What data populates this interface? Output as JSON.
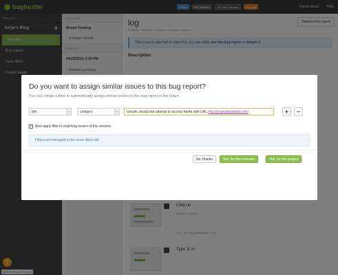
{
  "topbar": {
    "logo": "bugbuster",
    "badges": [
      "Follow",
      "583 followers",
      "42 / 800 minutes",
      "Buy now"
    ],
    "user": "Tuxnet cloud",
    "help": "Help"
  },
  "sidebar": {
    "header": "PROJECT",
    "project": "Jorge's Blog",
    "items": [
      "Test plan",
      "Bug reports",
      "Issue filters",
      "Project details"
    ]
  },
  "col2": {
    "header": "SCENARIO",
    "title": "Bread Testing",
    "item": "Scenario Details",
    "section": "SESSION",
    "date": "04/23/2014, 5:03 PM",
    "summary": "Session summary"
  },
  "main": {
    "title": "log",
    "breadcrumb": "Projects > Test plan > Sessions > Issues in session",
    "detach": "Detach from report",
    "info_prefix": "This issue is attached to report #3, you can either",
    "info_link1": "see the bug report",
    "info_mid": "or",
    "info_link2": "detach it",
    "description": "Description",
    "step1_title": "Click on",
    "step1_sub": "Adjusted element",
    "step1_url": "URL: http://jorgealbaladejo.com/",
    "step2_title": "Type 'a' in"
  },
  "footer": {
    "version": "v2.1.0",
    "terms": "Terms",
    "privacy": "Privacy"
  },
  "modal": {
    "title": "Do you want to assign similar issues to this bug report?",
    "lead": "You can create a filter to automatically assign similar issues to this bug report in the future.",
    "field": "title",
    "operator": "contains",
    "value_text": "Unsafe JavaScript attempt to access frame with URL ",
    "value_url": "http://jorgealbaladejo.com/",
    "add": "+",
    "remove": "−",
    "apply_label": "Also apply filter to matching issues of this session.",
    "note_prefix": "Filters are managed in the ",
    "note_link": "issue filters",
    "note_suffix": " tab",
    "no_thanks": "No, thanks",
    "yes_scenario": "Yes, for this scenario",
    "yes_project": "Yes, for this project"
  },
  "colors": {
    "accent": "#8cbf4c",
    "topbar": "#3b3b3b",
    "sidebar": "#454545",
    "link": "#3d7dc2"
  }
}
